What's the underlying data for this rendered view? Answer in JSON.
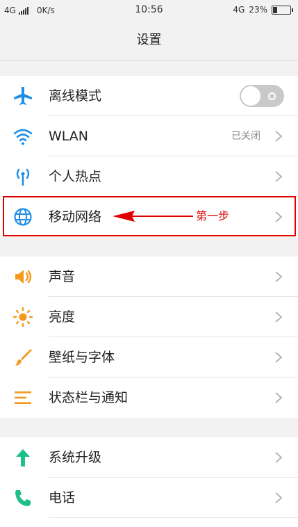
{
  "status_bar": {
    "network_left": "4G",
    "speed": "0K/s",
    "time": "10:56",
    "network_right": "4G",
    "battery_percent": "23%",
    "battery_level": 0.23
  },
  "header": {
    "title": "设置"
  },
  "groups": [
    {
      "items": [
        {
          "label": "离线模式",
          "icon": "airplane-icon",
          "control": "toggle",
          "toggle_on": false
        },
        {
          "label": "WLAN",
          "icon": "wifi-icon",
          "value": "已关闭"
        },
        {
          "label": "个人热点",
          "icon": "hotspot-icon"
        },
        {
          "label": "移动网络",
          "icon": "globe-icon"
        }
      ]
    },
    {
      "items": [
        {
          "label": "声音",
          "icon": "speaker-icon"
        },
        {
          "label": "亮度",
          "icon": "sun-icon"
        },
        {
          "label": "壁纸与字体",
          "icon": "brush-icon"
        },
        {
          "label": "状态栏与通知",
          "icon": "list-icon"
        }
      ]
    },
    {
      "items": [
        {
          "label": "系统升级",
          "icon": "arrow-up-icon"
        },
        {
          "label": "电话",
          "icon": "phone-icon"
        }
      ]
    }
  ],
  "annotation": {
    "text": "第一步",
    "color": "#e00000"
  },
  "colors": {
    "icon_blue": "#1e8fe8",
    "icon_orange": "#f39a1c",
    "icon_green": "#1fbf8a",
    "annotation_red": "#e00000"
  }
}
